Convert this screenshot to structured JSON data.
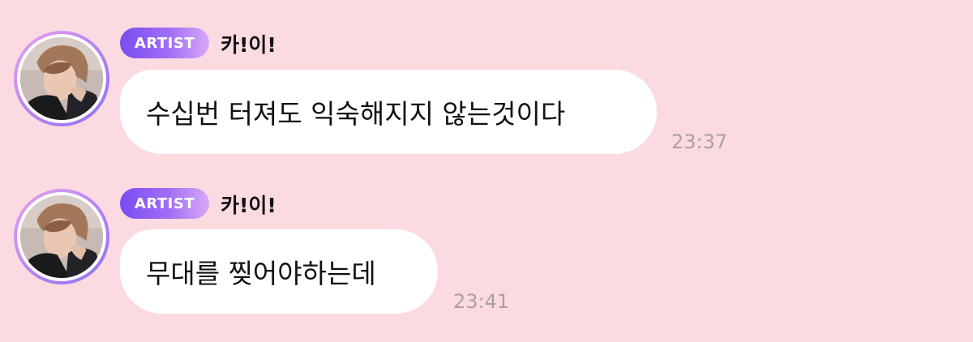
{
  "messages": [
    {
      "badge": "ARTIST",
      "sender": "카!이!",
      "text": "수십번 터져도 익숙해지지 않는것이다",
      "time": "23:37",
      "avatar_icon": "profile-photo"
    },
    {
      "badge": "ARTIST",
      "sender": "카!이!",
      "text": "무대를 찢어야하는데",
      "time": "23:41",
      "avatar_icon": "profile-photo"
    }
  ],
  "colors": {
    "background": "#fbdbe1",
    "bubble": "#ffffff",
    "badge_start": "#7a4cf0",
    "badge_end": "#d9a8f5",
    "time": "#a9a1a3"
  }
}
